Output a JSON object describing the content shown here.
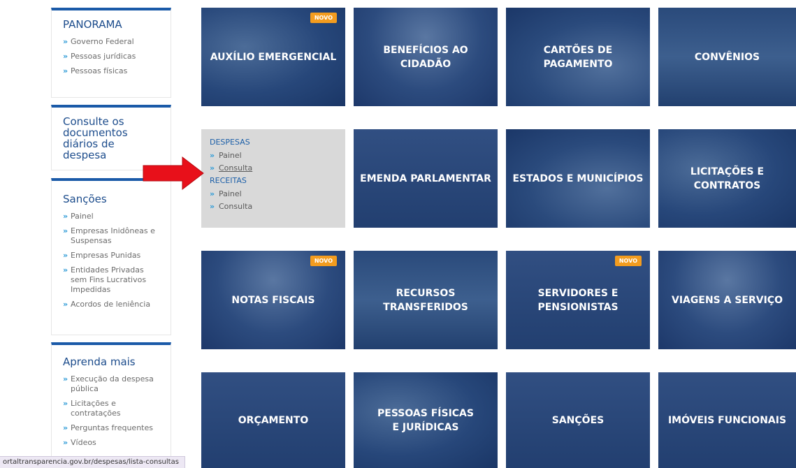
{
  "sidebar": {
    "panorama": {
      "title": "PANORAMA",
      "items": [
        "Governo Federal",
        "Pessoas jurídicas",
        "Pessoas físicas"
      ]
    },
    "consulte": {
      "title": "Consulte os documentos diários de despesa"
    },
    "sancoes": {
      "title": "Sanções",
      "items": [
        "Painel",
        "Empresas Inidôneas e Suspensas",
        "Empresas Punidas",
        "Entidades Privadas sem Fins Lucrativos Impedidas",
        "Acordos de leniência"
      ]
    },
    "aprenda": {
      "title": "Aprenda mais",
      "items": [
        "Execução da despesa pública",
        "Licitações e contratações",
        "Perguntas frequentes",
        "Vídeos"
      ]
    }
  },
  "tiles": {
    "auxilio": {
      "label": "AUXÍLIO EMERGENCIAL",
      "badge": "NOVO"
    },
    "beneficios": {
      "label": "BENEFÍCIOS AO CIDADÃO"
    },
    "cartoes": {
      "label": "CARTÕES DE PAGAMENTO"
    },
    "convenios": {
      "label": "CONVÊNIOS"
    },
    "emenda": {
      "label": "EMENDA PARLAMENTAR"
    },
    "estados": {
      "label": "ESTADOS E MUNICÍPIOS"
    },
    "licitacoes": {
      "label": "LICITAÇÕES E CONTRATOS"
    },
    "notas": {
      "label": "NOTAS FISCAIS",
      "badge": "NOVO"
    },
    "recursos": {
      "label": "RECURSOS TRANSFERIDOS"
    },
    "servidores": {
      "label": "SERVIDORES E PENSIONISTAS",
      "badge": "NOVO"
    },
    "viagens": {
      "label": "VIAGENS A SERVIÇO"
    },
    "orcamento": {
      "label": "ORÇAMENTO"
    },
    "pessoas": {
      "label": "PESSOAS FÍSICAS E JURÍDICAS"
    },
    "sancoes": {
      "label": "SANÇÕES"
    },
    "imoveis": {
      "label": "IMÓVEIS FUNCIONAIS"
    }
  },
  "despesas_panel": {
    "despesas_heading": "DESPESAS",
    "despesas_items": [
      "Painel",
      "Consulta"
    ],
    "receitas_heading": "RECEITAS",
    "receitas_items": [
      "Painel",
      "Consulta"
    ]
  },
  "statusbar": {
    "url": "ortaltransparencia.gov.br/despesas/lista-consultas"
  },
  "colors": {
    "accent_blue": "#1a5aa8",
    "badge_orange": "#f39c1f",
    "arrow_red": "#e8101a"
  },
  "icons": {
    "list_bullet": "»"
  }
}
